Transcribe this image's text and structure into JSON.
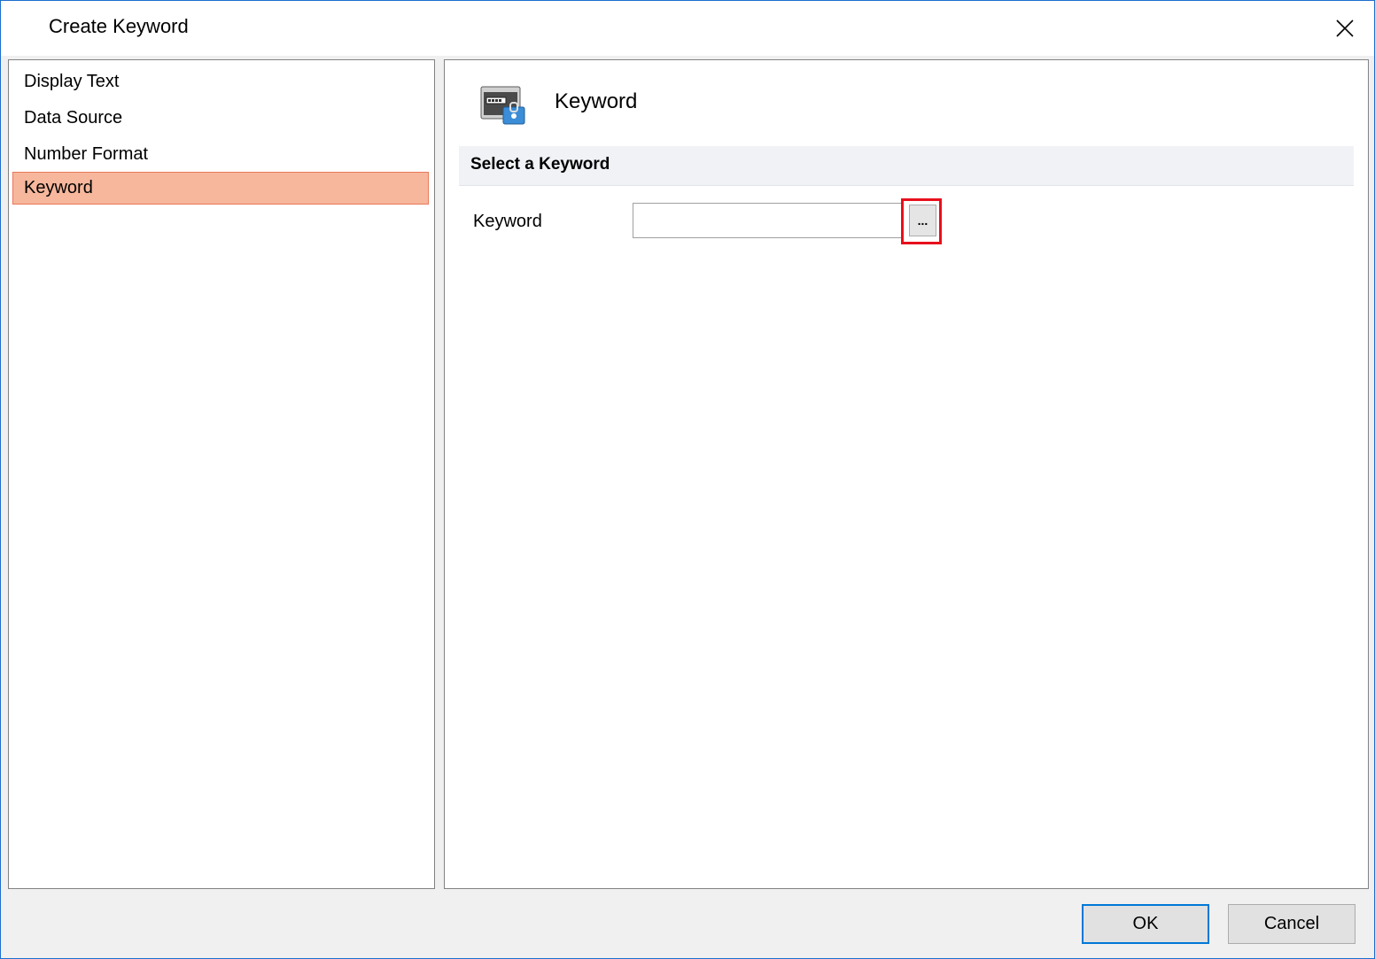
{
  "window": {
    "title": "Create Keyword"
  },
  "nav": {
    "items": [
      {
        "label": "Display Text",
        "selected": false
      },
      {
        "label": "Data Source",
        "selected": false
      },
      {
        "label": "Number Format",
        "selected": false
      },
      {
        "label": "Keyword",
        "selected": true
      }
    ]
  },
  "page": {
    "icon": "keyword-icon",
    "heading": "Keyword",
    "section_title": "Select a Keyword",
    "keyword_field": {
      "label": "Keyword",
      "value": "",
      "browse_label": "..."
    }
  },
  "footer": {
    "ok_label": "OK",
    "cancel_label": "Cancel"
  },
  "colors": {
    "accent": "#0078d7",
    "selected_bg": "#f7b79c",
    "selected_border": "#e9785b",
    "highlight": "#e8101c"
  }
}
